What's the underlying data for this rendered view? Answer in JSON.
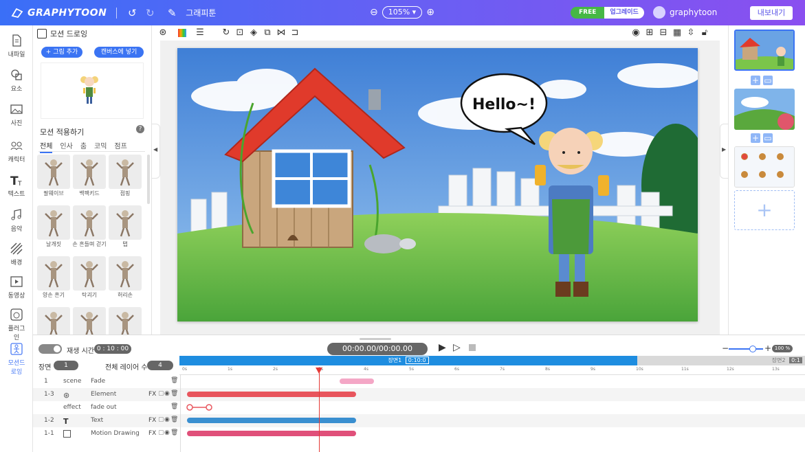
{
  "app": {
    "brand": "GRAPHYTOON",
    "doc_title": "그래피툰",
    "zoom": "105% ▾",
    "plan": "FREE",
    "upgrade": "업그레이드",
    "user": "graphytoon",
    "export": "내보내기"
  },
  "nav": [
    {
      "label": "내파일",
      "icon": "file-icon"
    },
    {
      "label": "요소",
      "icon": "shapes-icon"
    },
    {
      "label": "사진",
      "icon": "photo-icon"
    },
    {
      "label": "캐릭터",
      "icon": "character-icon"
    },
    {
      "label": "텍스트",
      "icon": "text-icon"
    },
    {
      "label": "음악",
      "icon": "music-icon"
    },
    {
      "label": "배경",
      "icon": "background-icon"
    },
    {
      "label": "동영상",
      "icon": "video-icon"
    },
    {
      "label": "플러그인",
      "icon": "plugin-icon"
    },
    {
      "label": "모션드로잉",
      "icon": "motion-drawing-icon"
    }
  ],
  "panel": {
    "title": "모션 드로잉",
    "add_image": "+ 그림 추가",
    "insert_canvas": "캔버스에 넣기",
    "section_title": "모션 적용하기",
    "help": "?",
    "categories": [
      "전체",
      "인사",
      "춤",
      "코믹",
      "점프"
    ],
    "motions": [
      "팔웨이브",
      "백팩키드",
      "점핑",
      "날개짓",
      "손 흔들며 걷기",
      "탭",
      "양손 흔기",
      "탁괴기",
      "허리손",
      "",
      "",
      ""
    ]
  },
  "canvas": {
    "speech": "Hello~!"
  },
  "timeline": {
    "play_time_label": "재생 시간",
    "play_time": "0 : 10 : 00",
    "time": "00:00.00/00:00.00",
    "scene_label": "장면",
    "scene_num": "1",
    "layer_label": "전체 레이어 수",
    "layer_count": "4",
    "scene1": "장면1",
    "scene1_time": "0:10:0",
    "scene2": "장면2",
    "scene2_time": "0:1",
    "zoom": "100 %",
    "ruler": [
      "0s",
      "1s",
      "2s",
      "3s",
      "4s",
      "5s",
      "6s",
      "7s",
      "8s",
      "9s",
      "10s",
      "11s",
      "12s",
      "13s"
    ],
    "rows": [
      {
        "c1": "1",
        "c2": "scene",
        "c3": "Fade",
        "fx": ""
      },
      {
        "c1": "1-3",
        "c2": "",
        "c3": "Element",
        "fx": "FX"
      },
      {
        "c1": "",
        "c2": "effect",
        "c3": "fade out",
        "fx": ""
      },
      {
        "c1": "1-2",
        "c2": "",
        "c3": "Text",
        "fx": "FX"
      },
      {
        "c1": "1-1",
        "c2": "",
        "c3": "Motion Drawing",
        "fx": "FX"
      }
    ]
  },
  "colors": {
    "accent": "#3b74f3",
    "scene_bar": "#1e8de0",
    "bar_pink": "#f4a7c6",
    "bar_red": "#e8555d",
    "bar_blue": "#3a8fd0",
    "bar_magenta": "#e0507a",
    "playhead": "#e53935"
  }
}
